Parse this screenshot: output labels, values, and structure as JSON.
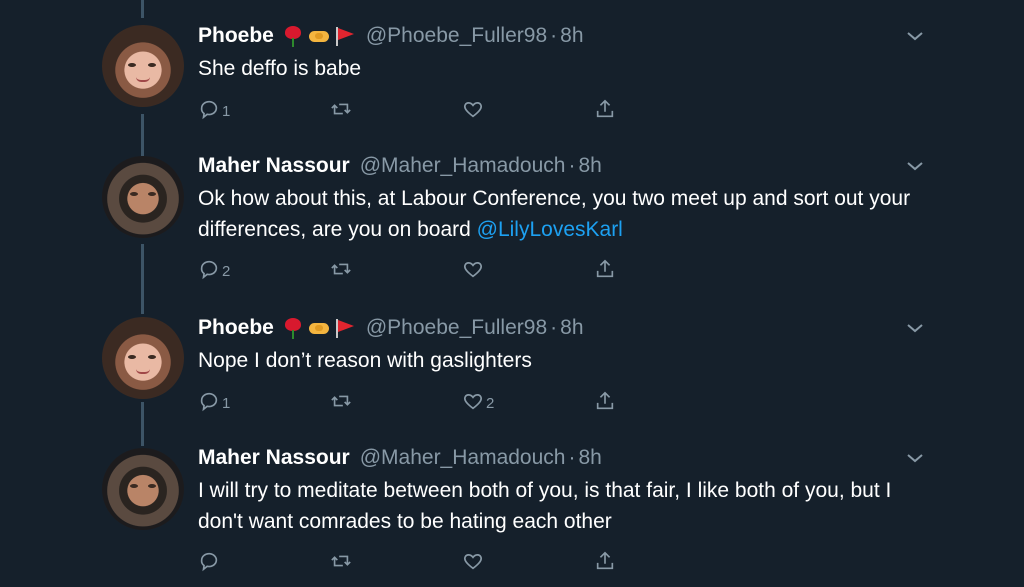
{
  "tweets": [
    {
      "name": "Phoebe",
      "emojis": [
        "rose-emoji",
        "handshake-emoji",
        "red-flag-emoji"
      ],
      "handle": "@Phoebe_Fuller98",
      "separator": "·",
      "time": "8h",
      "text": "She deffo is babe",
      "mention": "",
      "reply_count": "1",
      "like_count": "",
      "avatar": "phoebe"
    },
    {
      "name": "Maher Nassour",
      "emojis": [],
      "handle": "@Maher_Hamadouch",
      "separator": "·",
      "time": "8h",
      "text": "Ok how about this, at Labour Conference, you two meet up and sort out your differences, are you on board ",
      "mention": "@LilyLovesKarl",
      "reply_count": "2",
      "like_count": "",
      "avatar": "maher"
    },
    {
      "name": "Phoebe",
      "emojis": [
        "rose-emoji",
        "handshake-emoji",
        "red-flag-emoji"
      ],
      "handle": "@Phoebe_Fuller98",
      "separator": "·",
      "time": "8h",
      "text": "Nope I don’t reason with gaslighters",
      "mention": "",
      "reply_count": "1",
      "like_count": "2",
      "avatar": "phoebe"
    },
    {
      "name": "Maher Nassour",
      "emojis": [],
      "handle": "@Maher_Hamadouch",
      "separator": "·",
      "time": "8h",
      "text": "I will try to meditate between both of you, is that fair, I like both of you, but I don't want comrades to be hating each other",
      "mention": "",
      "reply_count": "",
      "like_count": "",
      "avatar": "maher"
    }
  ],
  "colors": {
    "background": "#15202b",
    "secondary_text": "#8899a6",
    "link": "#1da1f2",
    "thread_line": "#3d5466"
  },
  "icons": [
    "reply-icon",
    "retweet-icon",
    "like-icon",
    "share-icon",
    "chevron-down-icon"
  ]
}
